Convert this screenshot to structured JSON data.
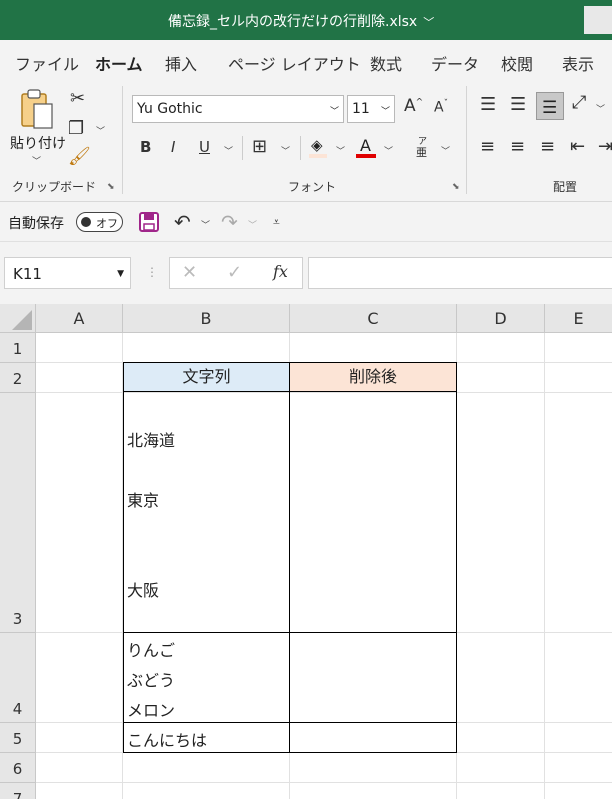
{
  "window": {
    "title": "備忘録_セル内の改行だけの行削除.xlsx"
  },
  "tabs": [
    "ファイル",
    "ホーム",
    "挿入",
    "ページ レイアウト",
    "数式",
    "データ",
    "校閲",
    "表示"
  ],
  "active_tab": "ホーム",
  "ribbon": {
    "clipboard": {
      "paste_label": "貼り付け",
      "group_label": "クリップボード"
    },
    "font": {
      "font_name": "Yu Gothic",
      "font_size": "11",
      "group_label": "フォント",
      "bold": "B",
      "italic": "I",
      "underline": "U",
      "font_color_glyph": "A",
      "phonetic_top": "ア",
      "phonetic_bottom": "亜"
    },
    "alignment": {
      "group_label": "配置"
    }
  },
  "qat": {
    "autosave_label": "自動保存",
    "toggle_state": "オフ"
  },
  "formula_bar": {
    "name_box": "K11",
    "fx": "fx",
    "formula": ""
  },
  "colors": {
    "accent": "#217346",
    "header_b": "#ddebf7",
    "header_c": "#fce4d6",
    "font_color_bar": "#e00000"
  },
  "sheet": {
    "columns": [
      "A",
      "B",
      "C",
      "D",
      "E"
    ],
    "rows": [
      "1",
      "2",
      "3",
      "4",
      "5",
      "6",
      "7"
    ],
    "header_b": "文字列",
    "header_c": "削除後",
    "b3": [
      "北海道",
      "東京",
      "大阪"
    ],
    "b4": [
      "りんご",
      "ぶどう",
      "メロン"
    ],
    "b5": "こんにちは"
  }
}
